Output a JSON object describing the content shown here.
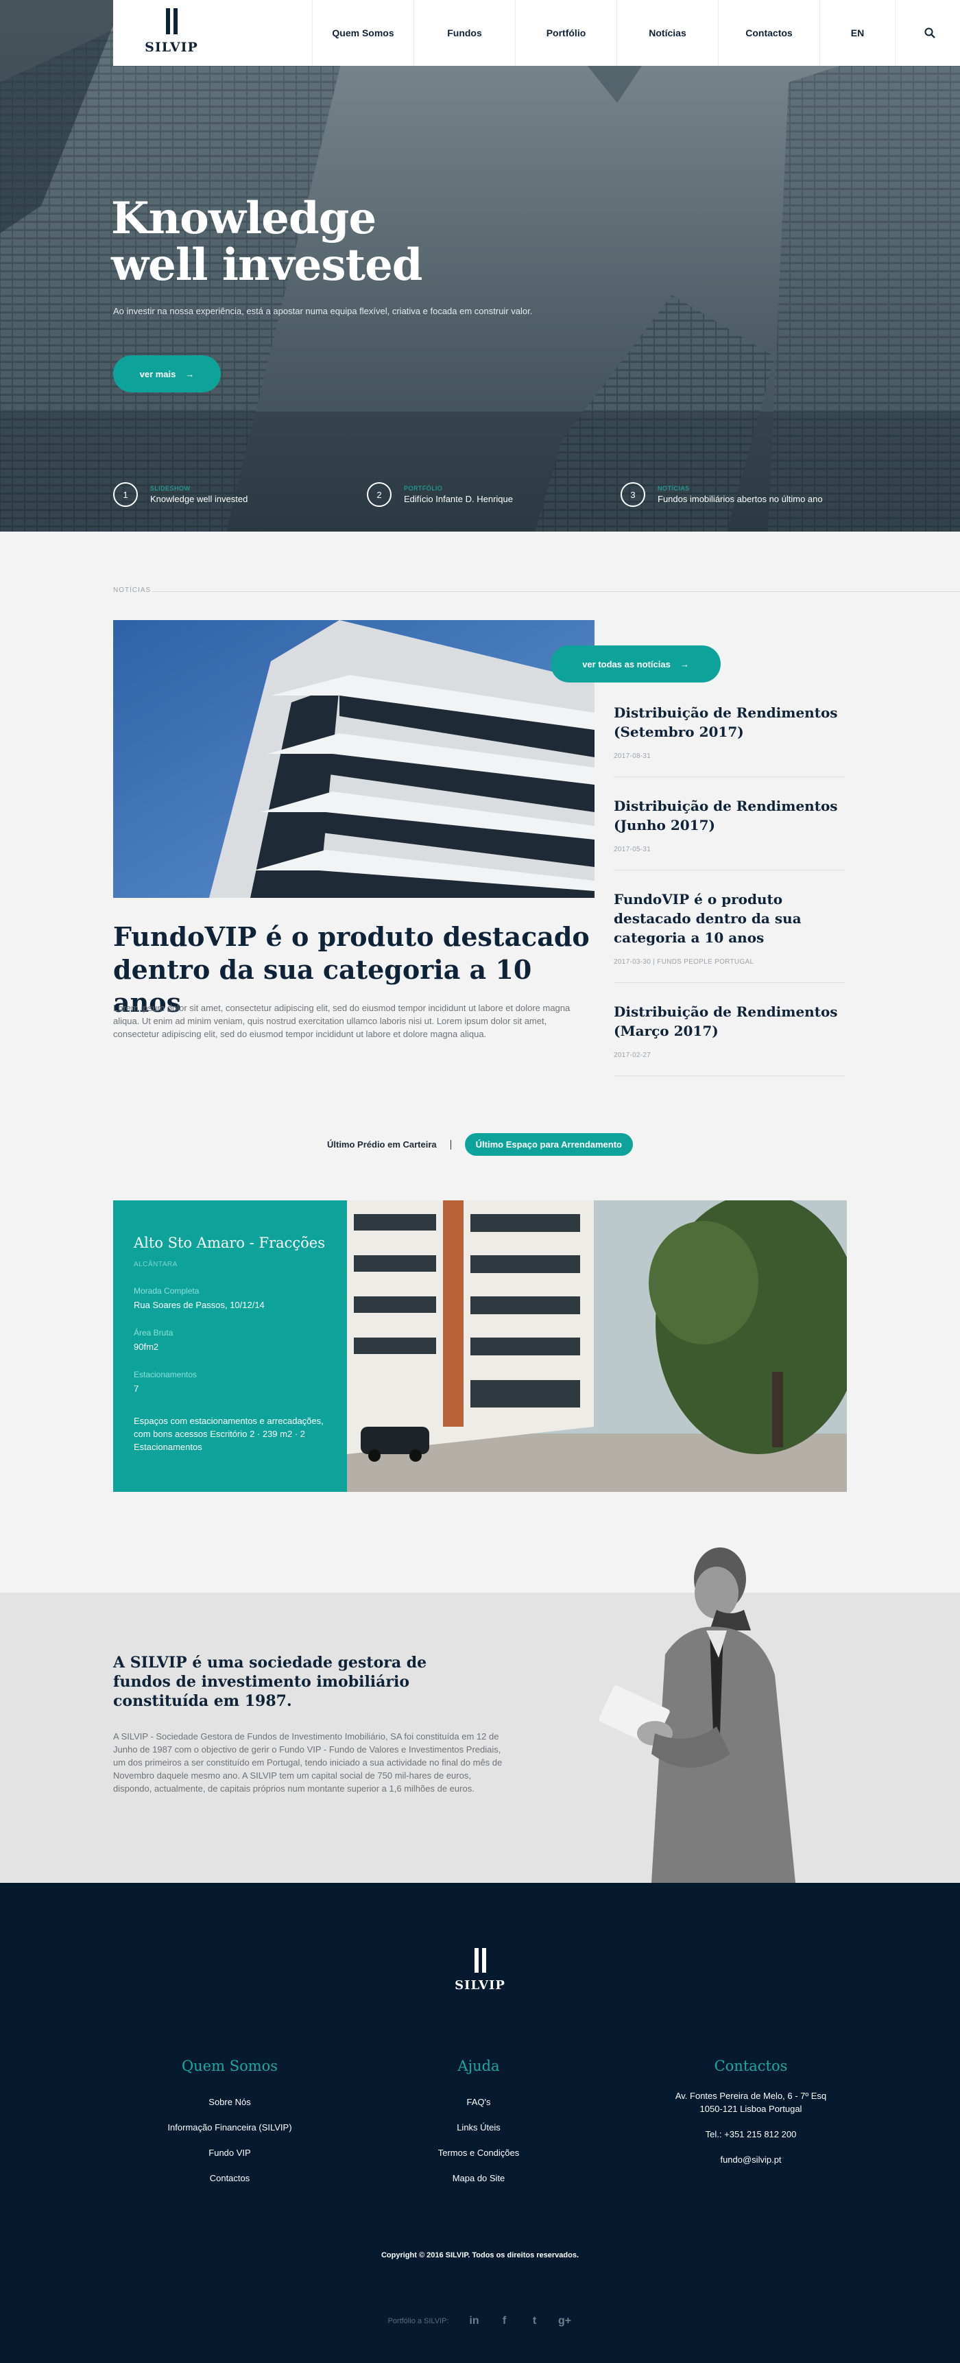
{
  "header": {
    "logo_text": "SILVIP",
    "nav": [
      {
        "label": "Quem Somos"
      },
      {
        "label": "Fundos"
      },
      {
        "label": "Portfólio"
      },
      {
        "label": "Notícias"
      },
      {
        "label": "Contactos"
      }
    ],
    "lang": "EN",
    "search_icon": "search-icon"
  },
  "hero": {
    "title_line1": "Knowledge",
    "title_line2": "well invested",
    "subtitle": "Ao investir na nossa experiência, está a apostar numa equipa flexível, criativa e focada em construir valor.",
    "cta": "ver mais",
    "steps": [
      {
        "num": "1",
        "label": "SLIDESHOW",
        "value": "Knowledge well invested"
      },
      {
        "num": "2",
        "label": "PORTFÓLIO",
        "value": "Edifício Infante D. Henrique"
      },
      {
        "num": "3",
        "label": "NOTÍCIAS",
        "value": "Fundos imobiliários abertos no último ano"
      }
    ]
  },
  "news": {
    "section_label": "NOTÍCIAS",
    "see_all": "ver todas as notícias",
    "featured_title": "FundoVIP é o produto destacado dentro da sua categoria a 10 anos",
    "featured_body": "Lorem ipsum dolor sit amet, consectetur adipiscing elit, sed do eiusmod tempor incididunt ut labore et dolore magna aliqua. Ut enim ad minim veniam, quis nostrud exercitation ullamco laboris nisi ut. Lorem ipsum dolor sit amet, consectetur adipiscing elit, sed do eiusmod tempor incididunt ut labore et dolore magna aliqua.",
    "items": [
      {
        "title": "Distribuição de Rendimentos (Setembro 2017)",
        "date": "2017-08-31"
      },
      {
        "title": "Distribuição de Rendimentos (Junho 2017)",
        "date": "2017-05-31"
      },
      {
        "title": "FundoVIP é o produto destacado dentro da sua categoria a 10 anos",
        "date": "2017-03-30 | FUNDS PEOPLE PORTUGAL"
      },
      {
        "title": "Distribuição de Rendimentos (Março 2017)",
        "date": "2017-02-27"
      }
    ]
  },
  "property": {
    "tab_inactive": "Último Prédio em Carteira",
    "tab_active": "Último Espaço para Arrendamento",
    "name": "Alto Sto Amaro - Fracções",
    "location": "ALCÂNTARA",
    "address_label": "Morada Completa",
    "address": "Rua Soares de Passos, 10/12/14",
    "area_label": "Área Bruta",
    "area": "90fm2",
    "parking_label": "Estacionamentos",
    "parking": "7",
    "description": "Espaços com estacionamentos e arrecadações, com bons acessos Escritório 2 · 239 m2 · 2 Estacionamentos"
  },
  "about": {
    "title": "A SILVIP é uma sociedade gestora de fundos de investimento imobiliário constituída em 1987.",
    "body": "A SILVIP - Sociedade Gestora de Fundos de Investimento Imobiliário, SA foi constituída em 12 de Junho de 1987 com o objectivo de gerir o Fundo VIP - Fundo de Valores e Investimentos Prediais, um dos primeiros a ser constituído em Portugal, tendo iniciado a sua actividade no final do mês de Novembro daquele mesmo ano. A SILVIP tem um capital social de 750 mil-hares de euros, dispondo, actualmente, de capitais próprios num montante superior a 1,6 milhões de euros."
  },
  "footer": {
    "logo_text": "SILVIP",
    "col1_title": "Quem Somos",
    "col1_links": [
      "Sobre Nós",
      "Informação Financeira (SILVIP)",
      "Fundo VIP",
      "Contactos"
    ],
    "col2_title": "Ajuda",
    "col2_links": [
      "FAQ's",
      "Links Úteis",
      "Termos e Condições",
      "Mapa do Site"
    ],
    "col3_title": "Contactos",
    "address_line1": "Av. Fontes Pereira de Melo, 6 - 7º Esq",
    "address_line2": "1050-121 Lisboa Portugal",
    "phone": "Tel.: +351 215 812 200",
    "email": "fundo@silvip.pt",
    "copyright": "Copyright © 2016 SILVIP. Todos os direitos reservados.",
    "social_label": "Portfólio a SILVIP:",
    "social_icons": [
      "linkedin-icon",
      "facebook-icon",
      "twitter-icon",
      "googleplus-icon"
    ],
    "social_glyphs": [
      "in",
      "f",
      "t",
      "g+"
    ]
  },
  "colors": {
    "accent": "#0ea39a",
    "navy": "#0e2238",
    "footer": "#051a2e"
  }
}
